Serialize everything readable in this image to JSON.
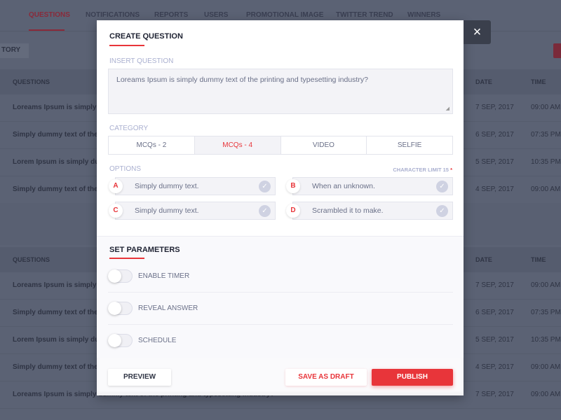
{
  "nav": {
    "tabs": [
      "QUESTIONS",
      "NOTIFICATIONS",
      "REPORTS",
      "USERS",
      "PROMOTIONAL IMAGE",
      "TWITTER TREND",
      "WINNERS"
    ],
    "active": "QUESTIONS"
  },
  "history_button": "TORY",
  "table": {
    "headers": {
      "questions": "QUESTIONS",
      "date": "DATE",
      "time": "TIME"
    },
    "rows1": [
      {
        "q": "Loreams Ipsum is simply",
        "date": "7 SEP, 2017",
        "time": "09:00 AM"
      },
      {
        "q": "Simply dummy text of the",
        "date": "6 SEP, 2017",
        "time": "07:35 PM"
      },
      {
        "q": "Lorem Ipsum is simply du",
        "date": "5 SEP, 2017",
        "time": "10:35 PM"
      },
      {
        "q": "Simply dummy text of the",
        "date": "4 SEP, 2017",
        "time": "09:00 AM"
      }
    ],
    "rows2": [
      {
        "q": "Loreams Ipsum is simply",
        "date": "7 SEP, 2017",
        "time": "09:00 AM"
      },
      {
        "q": "Simply dummy text of the",
        "date": "6 SEP, 2017",
        "time": "07:35 PM"
      },
      {
        "q": "Lorem Ipsum is simply du",
        "date": "5 SEP, 2017",
        "time": "10:35 PM"
      },
      {
        "q": "Simply dummy text of the",
        "date": "4 SEP, 2017",
        "time": "09:00 AM"
      },
      {
        "q": "Loreams Ipsum is simply dummy text of the printing and typesetting industry?",
        "date": "7 SEP, 2017",
        "time": "09:00 AM"
      }
    ]
  },
  "modal": {
    "title": "CREATE QUESTION",
    "close": "×",
    "insert_label": "INSERT QUESTION",
    "question": "Loreams Ipsum is simply dummy text of the printing and typesetting industry?",
    "category_label": "CATEGORY",
    "categories": [
      "MCQs - 2",
      "MCQs - 4",
      "VIDEO",
      "SELFIE"
    ],
    "selected_category": "MCQs - 4",
    "options_label": "OPTIONS",
    "char_limit": "CHARACTER LIMIT 15",
    "required_mark": "*",
    "options": [
      {
        "letter": "A",
        "text": "Simply dummy text."
      },
      {
        "letter": "B",
        "text": "When an unknown."
      },
      {
        "letter": "C",
        "text": "Simply dummy text."
      },
      {
        "letter": "D",
        "text": "Scrambled it to make."
      }
    ],
    "params_title": "SET PARAMETERS",
    "params": [
      {
        "label": "ENABLE TIMER",
        "on": false
      },
      {
        "label": "REVEAL ANSWER",
        "on": false
      },
      {
        "label": "SCHEDULE",
        "on": false
      }
    ],
    "preview": "PREVIEW",
    "save_draft": "SAVE AS DRAFT",
    "publish": "PUBLISH"
  },
  "colors": {
    "accent": "#e8353a",
    "overlay": "#5b6274"
  }
}
